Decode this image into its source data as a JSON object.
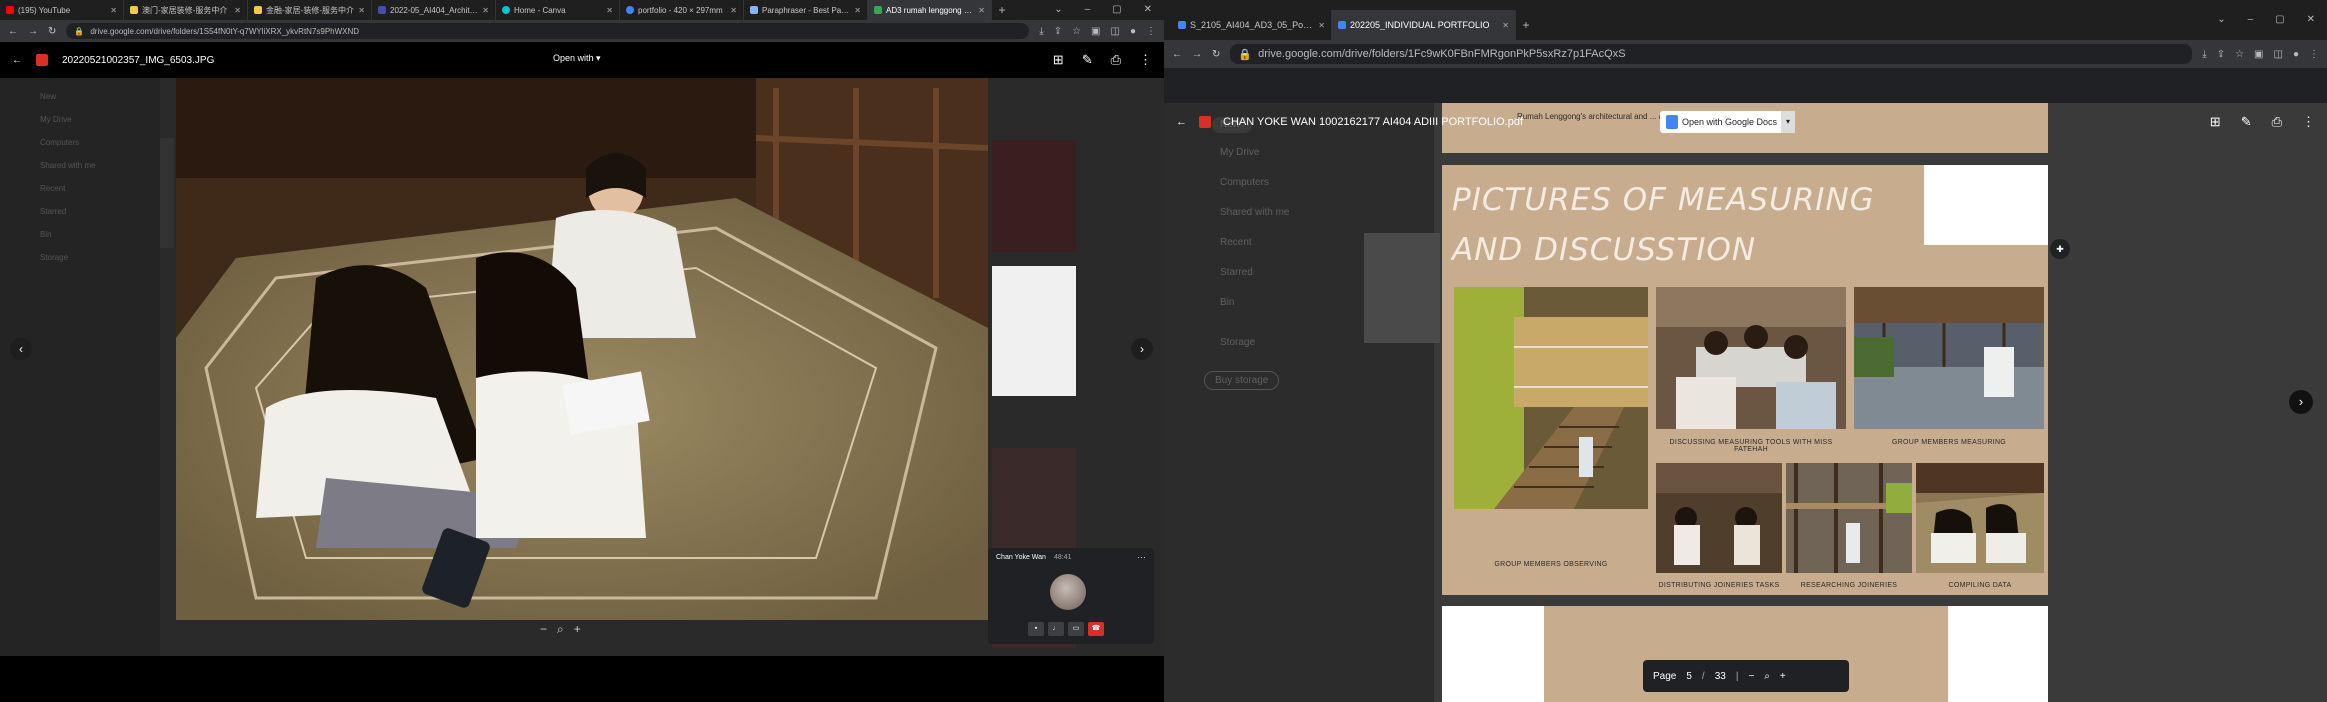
{
  "left": {
    "tabs": [
      {
        "title": "(195) YouTube",
        "color": "#ff0000"
      },
      {
        "title": "澳门-家居装修-服务中介",
        "color": "#f2c94c"
      },
      {
        "title": "金融-家居-装修-服务中介",
        "color": "#f2c94c"
      },
      {
        "title": "2022-05_AI404_Architectu",
        "color": "#444ea8"
      },
      {
        "title": "Home - Canva",
        "color": "#00c4cc"
      },
      {
        "title": "portfolio - 420 × 297mm",
        "color": "#4285f4"
      },
      {
        "title": "Paraphraser - Best Paraph",
        "color": "#8ab4f8"
      },
      {
        "title": "AD3 rumah lenggong - Go",
        "color": "#34a853"
      }
    ],
    "url": "drive.google.com/drive/folders/1S54fN0tY-q7WYliXRX_ykvRtN7s9PhWXND",
    "viewer": {
      "file_name": "20220521002357_IMG_6503.JPG",
      "open_with": "Open with"
    },
    "drive_sidebar": [
      "New",
      "My Drive",
      "Computers",
      "Shared with me",
      "Recent",
      "Starred",
      "Bin",
      "Storage"
    ],
    "meet": {
      "name": "Chan Yoke Wan",
      "time": "48:41"
    }
  },
  "right": {
    "tabs": [
      {
        "title": "S_2105_AI404_AD3_05_Portfolio",
        "color": "#4285f4"
      },
      {
        "title": "202205_INDIVIDUAL PORTFOLIO",
        "color": "#4285f4"
      }
    ],
    "url": "drive.google.com/drive/folders/1Fc9wK0FBnFMRgonPkP5sxRz7p1FAcQxS",
    "file_name": "CHAN YOKE WAN 1002162177 AI404 ADIII PORTFOLIO.pdf",
    "open_with_docs": "Open with Google Docs",
    "page_top_caption": "Rumah Lenggong's architectural and ... and it's been built in 1950.",
    "page_title": "PICTURES OF MEASURING AND DISCUSSTION",
    "photo_captions": {
      "observing": "GROUP MEMBERS OBSERVING",
      "discussing": "DISCUSSING MEASURING TOOLS WITH MISS FATEHAH",
      "measuring": "GROUP MEMBERS MEASURING",
      "distributing": "DISTRIBUTING JOINERIES TASKS",
      "researching": "RESEARCHING JOINERIES",
      "compiling": "COMPILING DATA"
    },
    "drive_sidebar": [
      "New",
      "My Drive",
      "Computers",
      "Shared with me",
      "Recent",
      "Starred",
      "Bin",
      "Storage",
      "Buy storage"
    ],
    "pager": {
      "label": "Page",
      "current": "5",
      "separator": "/",
      "total": "33"
    }
  }
}
